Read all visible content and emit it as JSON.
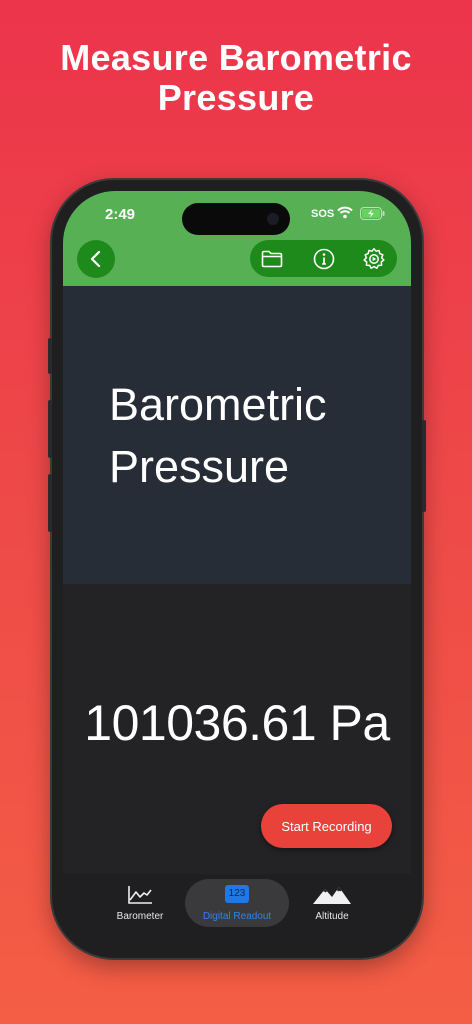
{
  "promo": {
    "headline_line1": "Measure Barometric",
    "headline_line2": "Pressure"
  },
  "status_bar": {
    "time": "2:49",
    "sos": "SOS",
    "icons": [
      "wifi-icon",
      "battery-charging-icon"
    ]
  },
  "toolbar": {
    "back_icon": "chevron-left-icon",
    "tools": [
      "folder-icon",
      "info-icon",
      "settings-gear-icon"
    ]
  },
  "panel": {
    "title_line1": "Barometric",
    "title_line2": "Pressure"
  },
  "readout": {
    "value": "101036.61 Pa",
    "record_label": "Start Recording"
  },
  "tabs": [
    {
      "label": "Barometer",
      "icon": "line-chart-icon",
      "active": false
    },
    {
      "label": "Digital Readout",
      "icon": "numeric-123-icon",
      "icon_text": "123",
      "active": true
    },
    {
      "label": "Altitude",
      "icon": "mountains-icon",
      "active": false
    }
  ],
  "colors": {
    "background_top": "#ec344b",
    "background_bottom": "#f45e45",
    "app_green": "#58b054",
    "button_green": "#1f8a1c",
    "record_red": "#e8423a",
    "active_tab_blue": "#2f83ee"
  }
}
